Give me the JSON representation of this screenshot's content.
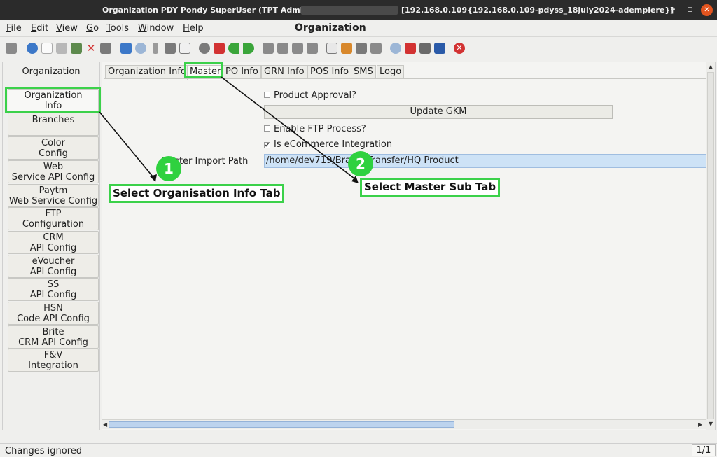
{
  "window": {
    "title_left": "Organization  PDY  Pondy  SuperUser (TPT Admin) @",
    "title_right": "[192.168.0.109{192.168.0.109-pdyss_18july2024-adempiere}]",
    "minimize": "–",
    "maximize": "▫",
    "close": "✕"
  },
  "menu": {
    "items": [
      "File",
      "Edit",
      "View",
      "Go",
      "Tools",
      "Window",
      "Help"
    ],
    "window_title": "Organization"
  },
  "toolbar": {
    "icons": [
      "undo-icon",
      "help-icon",
      "new-icon",
      "copy-icon",
      "save-icon",
      "delete-icon",
      "grid-toggle-icon",
      "refresh-icon",
      "find-icon",
      "attachment-icon",
      "chat-icon",
      "history-icon",
      "report-icon",
      "home-icon",
      "back-icon",
      "forward-icon",
      "first-record-icon",
      "previous-record-icon",
      "next-record-icon",
      "last-record-icon",
      "print-preview-icon",
      "archive-icon",
      "print-icon",
      "print-batch-icon",
      "zoom-across-icon",
      "workflow-icon",
      "product-info-icon",
      "close-window-icon"
    ],
    "colors": {
      "gray": "#7a7a7a",
      "blue": "#3c78c8",
      "green": "#3aa53a",
      "red": "#d23232",
      "orange": "#d8882c"
    }
  },
  "left_panel": {
    "header": "Organization",
    "tabs": [
      {
        "label": "Organization\nInfo",
        "selected": true
      },
      {
        "label": "Branches"
      },
      {
        "label": "Color\nConfig"
      },
      {
        "label": "Web\nService API Config"
      },
      {
        "label": "Paytm\nWeb Service Config"
      },
      {
        "label": "FTP\nConfiguration"
      },
      {
        "label": "CRM\nAPI Config"
      },
      {
        "label": "eVoucher\nAPI Config"
      },
      {
        "label": "SS\nAPI Config"
      },
      {
        "label": "HSN\nCode API Config"
      },
      {
        "label": "Brite\nCRM API Config"
      },
      {
        "label": "F&V\nIntegration"
      }
    ]
  },
  "sub_tabs": [
    {
      "label": "Organization Info"
    },
    {
      "label": "Master",
      "selected": true
    },
    {
      "label": "PO Info"
    },
    {
      "label": "GRN Info"
    },
    {
      "label": "POS Info"
    },
    {
      "label": "SMS"
    },
    {
      "label": "Logo"
    }
  ],
  "form": {
    "product_approval": {
      "label": "Product Approval?",
      "checked": false
    },
    "update_gkm_button": "Update GKM",
    "enable_ftp": {
      "label": "Enable FTP Process?",
      "checked": false
    },
    "ecommerce": {
      "label": "Is eCommerce Integration",
      "checked": true
    },
    "check_mark": "✔",
    "path_label": "Master Import Path",
    "path_value": "/home/dev719/BranchTransfer/HQ Product"
  },
  "status": {
    "message": "Changes ignored",
    "page": "1/1"
  },
  "annotations": {
    "step1": {
      "number": "1",
      "text": "Select Organisation Info Tab"
    },
    "step2": {
      "number": "2",
      "text": "Select Master Sub Tab"
    },
    "highlight_color": "#3bd14a"
  }
}
